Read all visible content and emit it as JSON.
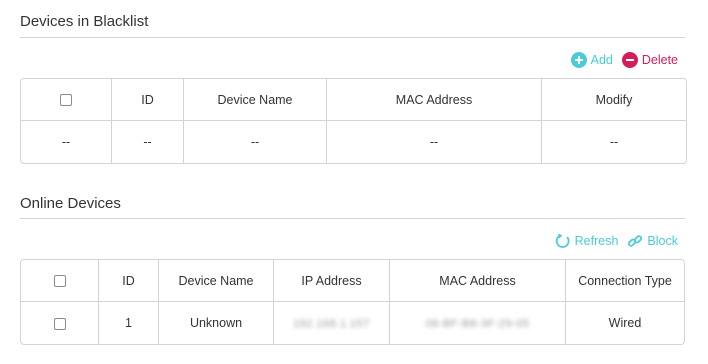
{
  "blacklist": {
    "title": "Devices in Blacklist",
    "add_label": "Add",
    "delete_label": "Delete",
    "columns": [
      "ID",
      "Device Name",
      "MAC Address",
      "Modify"
    ],
    "row": [
      "--",
      "--",
      "--",
      "--",
      "--"
    ]
  },
  "online": {
    "title": "Online Devices",
    "refresh_label": "Refresh",
    "block_label": "Block",
    "columns": [
      "ID",
      "Device Name",
      "IP Address",
      "MAC Address",
      "Connection Type"
    ],
    "rows": [
      {
        "id": "1",
        "device_name": "Unknown",
        "ip": "192.168.1.157",
        "mac": "08-BF-B8-3F-29-05",
        "connection_type": "Wired"
      }
    ]
  },
  "colors": {
    "accent": "#4acbd6",
    "danger": "#d31e5c",
    "border": "#d4d4d4"
  }
}
